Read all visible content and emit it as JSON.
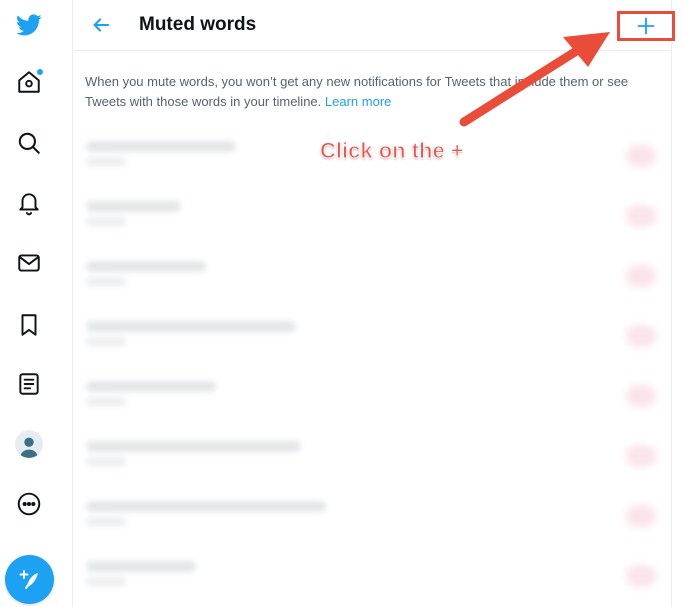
{
  "header": {
    "title": "Muted words"
  },
  "description": {
    "text": "When you mute words, you won’t get any new notifications for Tweets that include them or see Tweets with those words in your timeline.",
    "link_label": "Learn more"
  },
  "annotation": {
    "label": "Click on the +"
  },
  "colors": {
    "brand_blue": "#1da1f2",
    "highlight_red": "#e94d3a",
    "arrow_red": "#f0524a"
  },
  "sidebar": {
    "items": [
      {
        "name": "twitter-logo-icon"
      },
      {
        "name": "home-icon"
      },
      {
        "name": "explore-icon"
      },
      {
        "name": "notifications-bell-icon"
      },
      {
        "name": "messages-envelope-icon"
      },
      {
        "name": "bookmarks-icon"
      },
      {
        "name": "lists-icon"
      },
      {
        "name": "profile-avatar"
      },
      {
        "name": "more-icon"
      },
      {
        "name": "compose-tweet-icon"
      }
    ]
  }
}
